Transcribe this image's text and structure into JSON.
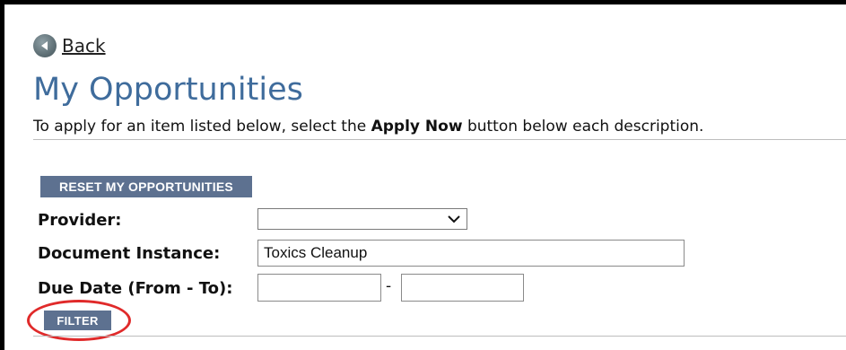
{
  "nav": {
    "back_label": "Back"
  },
  "header": {
    "title": "My Opportunities",
    "instructions_prefix": "To apply for an item listed below, select the ",
    "instructions_bold": "Apply Now",
    "instructions_suffix": " button below each description."
  },
  "actions": {
    "reset_label": "RESET MY OPPORTUNITIES",
    "filter_label": "FILTER"
  },
  "form": {
    "provider_label": "Provider:",
    "provider_value": "",
    "document_instance_label": "Document Instance:",
    "document_instance_value": "Toxics Cleanup",
    "due_date_label": "Due Date (From - To):",
    "due_date_from": "",
    "due_date_separator": "-",
    "due_date_to": ""
  },
  "colors": {
    "title": "#3f6c9c",
    "button_bg": "#5d7190",
    "highlight": "#e02a2a"
  }
}
